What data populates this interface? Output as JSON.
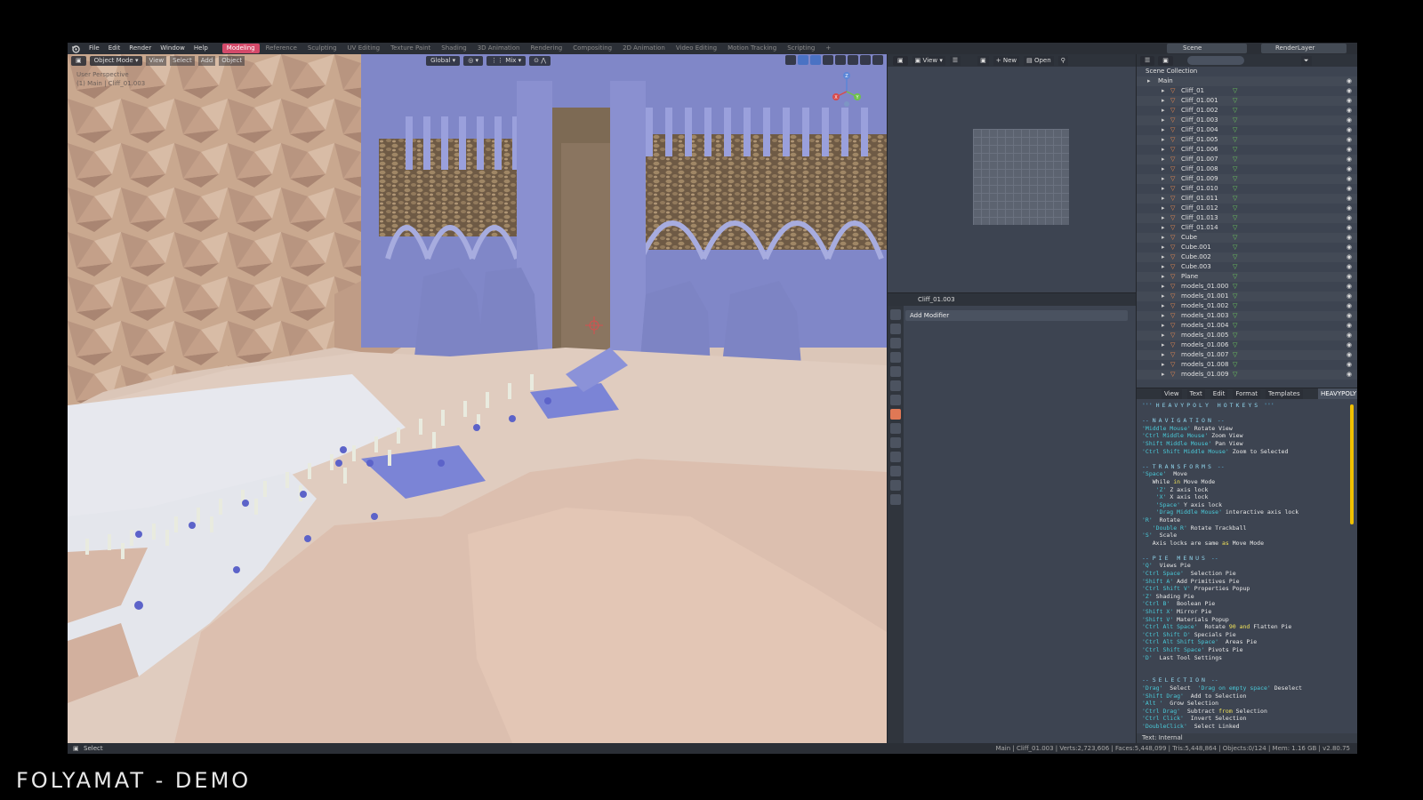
{
  "topbar": {
    "menu": [
      "File",
      "Edit",
      "Render",
      "Window",
      "Help"
    ],
    "workspaces": [
      "Modeling",
      "Reference",
      "Sculpting",
      "UV Editing",
      "Texture Paint",
      "Shading",
      "3D Animation",
      "Rendering",
      "Compositing",
      "2D Animation",
      "Video Editing",
      "Motion Tracking",
      "Scripting"
    ],
    "active_workspace": "Modeling",
    "add_tab": "+",
    "scene": "Scene",
    "render_layer": "RenderLayer"
  },
  "viewport": {
    "mode": "Object Mode",
    "menu": [
      "View",
      "Select",
      "Add",
      "Object"
    ],
    "orientation": "Global",
    "snap_mode": "Mix",
    "info_line1": "User Perspective",
    "info_line2": "(1) Main | Cliff_01.003",
    "gizmo_axes": [
      "Z",
      "X",
      "Y"
    ]
  },
  "image_editor": {
    "view_label": "View",
    "new_label": "New",
    "open_label": "Open"
  },
  "properties": {
    "object_name": "Cliff_01.003",
    "add_modifier_label": "Add Modifier"
  },
  "outliner": {
    "scene_collection": "Scene Collection",
    "main_collection": "Main",
    "objects": [
      "Cliff_01",
      "Cliff_01.001",
      "Cliff_01.002",
      "Cliff_01.003",
      "Cliff_01.004",
      "Cliff_01.005",
      "Cliff_01.006",
      "Cliff_01.007",
      "Cliff_01.008",
      "Cliff_01.009",
      "Cliff_01.010",
      "Cliff_01.011",
      "Cliff_01.012",
      "Cliff_01.013",
      "Cliff_01.014",
      "Cube",
      "Cube.001",
      "Cube.002",
      "Cube.003",
      "Plane",
      "models_01.000",
      "models_01.001",
      "models_01.002",
      "models_01.003",
      "models_01.004",
      "models_01.005",
      "models_01.006",
      "models_01.007",
      "models_01.008",
      "models_01.009"
    ]
  },
  "text_editor": {
    "menu": [
      "View",
      "Text",
      "Edit",
      "Format",
      "Templates"
    ],
    "document_name": "HEAVYPOLY",
    "footer": "Text: Internal",
    "lines": [
      [
        [
          "com",
          "''' "
        ],
        [
          "head",
          "HEAVYPOLY HOTKEYS"
        ],
        [
          "com",
          " '''"
        ]
      ],
      [],
      [
        [
          "com",
          "-- "
        ],
        [
          "head",
          "NAVIGATION"
        ],
        [
          "com",
          " --"
        ]
      ],
      [
        [
          "key",
          "'Middle Mouse'"
        ],
        [
          "txt",
          " Rotate View"
        ]
      ],
      [
        [
          "key",
          "'Ctrl Middle Mouse'"
        ],
        [
          "txt",
          " Zoom View"
        ]
      ],
      [
        [
          "key",
          "'Shift Middle Mouse'"
        ],
        [
          "txt",
          " Pan View"
        ]
      ],
      [
        [
          "key",
          "'Ctrl Shift Middle Mouse'"
        ],
        [
          "txt",
          " Zoom to Selected"
        ]
      ],
      [],
      [
        [
          "com",
          "-- "
        ],
        [
          "head",
          "TRANSFORMS"
        ],
        [
          "com",
          " --"
        ]
      ],
      [
        [
          "key",
          "'Space'"
        ],
        [
          "txt",
          "  Move"
        ]
      ],
      [
        [
          "txt",
          "   While "
        ],
        [
          "hl",
          "in"
        ],
        [
          "txt",
          " Move Mode"
        ]
      ],
      [
        [
          "key",
          "    'Z'"
        ],
        [
          "txt",
          " Z axis lock"
        ]
      ],
      [
        [
          "key",
          "    'X'"
        ],
        [
          "txt",
          " X axis lock"
        ]
      ],
      [
        [
          "key",
          "    'Space'"
        ],
        [
          "txt",
          " Y axis lock"
        ]
      ],
      [
        [
          "key",
          "    'Drag Middle Mouse'"
        ],
        [
          "txt",
          " interactive axis lock"
        ]
      ],
      [
        [
          "key",
          "'R'"
        ],
        [
          "txt",
          "  Rotate"
        ]
      ],
      [
        [
          "key",
          "   'Double R'"
        ],
        [
          "txt",
          " Rotate Trackball"
        ]
      ],
      [
        [
          "key",
          "'S'"
        ],
        [
          "txt",
          "  Scale"
        ]
      ],
      [
        [
          "txt",
          "   Axis locks are same "
        ],
        [
          "hl",
          "as"
        ],
        [
          "txt",
          " Move Mode"
        ]
      ],
      [],
      [
        [
          "com",
          "-- "
        ],
        [
          "head",
          "PIE MENUS"
        ],
        [
          "com",
          " --"
        ]
      ],
      [
        [
          "key",
          "'Q'"
        ],
        [
          "txt",
          "  Views Pie"
        ]
      ],
      [
        [
          "key",
          "'Ctrl Space'"
        ],
        [
          "txt",
          "  Selection Pie"
        ]
      ],
      [
        [
          "key",
          "'Shift A'"
        ],
        [
          "txt",
          " Add Primitives Pie"
        ]
      ],
      [
        [
          "key",
          "'Ctrl Shift V'"
        ],
        [
          "txt",
          " Properties Popup"
        ]
      ],
      [
        [
          "key",
          "'Z'"
        ],
        [
          "txt",
          " Shading Pie"
        ]
      ],
      [
        [
          "key",
          "'Ctrl B'"
        ],
        [
          "txt",
          "  Boolean Pie"
        ]
      ],
      [
        [
          "key",
          "'Shift X'"
        ],
        [
          "txt",
          " Mirror Pie"
        ]
      ],
      [
        [
          "key",
          "'Shift V'"
        ],
        [
          "txt",
          " Materials Popup"
        ]
      ],
      [
        [
          "key",
          "'Ctrl Alt Space'"
        ],
        [
          "txt",
          "  Rotate "
        ],
        [
          "hl",
          "90"
        ],
        [
          "txt",
          " "
        ],
        [
          "hl",
          "and"
        ],
        [
          "txt",
          " Flatten Pie"
        ]
      ],
      [
        [
          "key",
          "'Ctrl Shift D'"
        ],
        [
          "txt",
          " Specials Pie"
        ]
      ],
      [
        [
          "key",
          "'Ctrl Alt Shift Space'"
        ],
        [
          "txt",
          "  Areas Pie"
        ]
      ],
      [
        [
          "key",
          "'Ctrl Shift Space'"
        ],
        [
          "txt",
          " Pivots Pie"
        ]
      ],
      [
        [
          "key",
          "'D'"
        ],
        [
          "txt",
          "  Last Tool Settings"
        ]
      ],
      [],
      [],
      [
        [
          "com",
          "-- "
        ],
        [
          "head",
          "SELECTION"
        ],
        [
          "com",
          " --"
        ]
      ],
      [
        [
          "key",
          "'Drag'"
        ],
        [
          "txt",
          "  Select  "
        ],
        [
          "key",
          "'Drag on empty space'"
        ],
        [
          "txt",
          " Deselect"
        ]
      ],
      [
        [
          "key",
          "'Shift Drag'"
        ],
        [
          "txt",
          "  Add to Selection"
        ]
      ],
      [
        [
          "key",
          "'Alt '"
        ],
        [
          "txt",
          "  Grow Selection"
        ]
      ],
      [
        [
          "key",
          "'Ctrl Drag'"
        ],
        [
          "txt",
          "  Subtract "
        ],
        [
          "hl",
          "from"
        ],
        [
          "txt",
          " Selection"
        ]
      ],
      [
        [
          "key",
          "'Ctrl Click'"
        ],
        [
          "txt",
          "  Invert Selection"
        ]
      ],
      [
        [
          "key",
          "'DoubleClick'"
        ],
        [
          "txt",
          "  Select Linked"
        ]
      ]
    ]
  },
  "statusbar": {
    "select_label": "Select",
    "stats": "Main | Cliff_01.003 | Verts:2,723,606 | Faces:5,448,099 | Tris:5,448,864 | Objects:0/124 | Mem: 1.16 GB | v2.80.75"
  },
  "caption": "FOLYAMAT  -  DEMO",
  "colors": {
    "accent_pink": "#d44a6a",
    "object_orange": "#ee8c50",
    "mesh_green": "#6ecf5c",
    "scrollbar_yellow": "#f0c000"
  }
}
